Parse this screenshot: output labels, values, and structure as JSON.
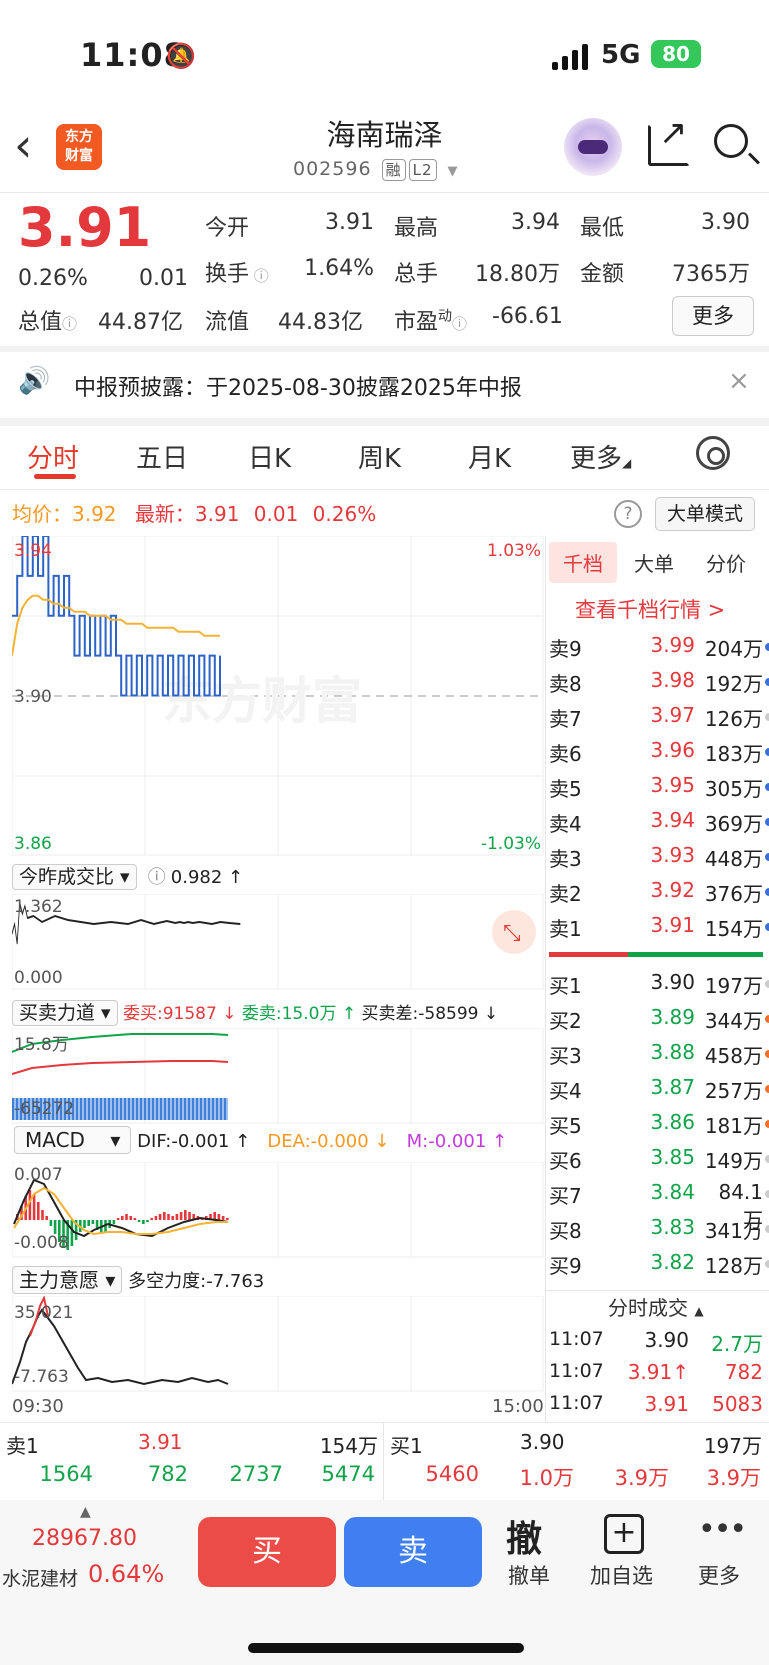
{
  "status_bar": {
    "time": "11:08",
    "network": "5G",
    "battery": "80"
  },
  "header": {
    "logo_text": "东方\n财富",
    "stock_name": "海南瑞泽",
    "stock_code": "002596",
    "tag_rong": "融",
    "tag_l2": "L2"
  },
  "quote": {
    "price": "3.91",
    "change_pct": "0.26%",
    "change": "0.01",
    "open_label": "今开",
    "open": "3.91",
    "high_label": "最高",
    "high": "3.94",
    "low_label": "最低",
    "low": "3.90",
    "turnover_label": "换手",
    "turnover": "1.64%",
    "volume_label": "总手",
    "volume": "18.80万",
    "amount_label": "金额",
    "amount": "7365万",
    "mktcap_label": "总值",
    "mktcap": "44.87亿",
    "float_label": "流值",
    "float": "44.83亿",
    "pe_label": "市盈",
    "pe_sup": "动",
    "pe": "-66.61",
    "more_label": "更多"
  },
  "notice": {
    "text": "中报预披露：于2025-08-30披露2025年中报"
  },
  "tabs": [
    "分时",
    "五日",
    "日K",
    "周K",
    "月K",
    "更多"
  ],
  "stats": {
    "avg_label": "均价：",
    "avg": "3.92",
    "latest_label": "最新：",
    "latest": "3.91",
    "chg": "0.01",
    "pct": "0.26%",
    "mode_label": "大单模式"
  },
  "chart_labels": {
    "top_price": "3.94",
    "mid_price": "3.90",
    "bottom_price": "3.86",
    "top_pct": "1.03%",
    "bottom_pct": "-1.03%",
    "watermark": "东方财富"
  },
  "chart_data": {
    "type": "line",
    "title": "",
    "y_range": [
      3.86,
      3.94
    ],
    "series": [
      {
        "name": "",
        "values": [
          3.92,
          3.93,
          3.94,
          3.93,
          3.94,
          3.93,
          3.94,
          3.92,
          3.93,
          3.92,
          3.93,
          3.92,
          3.91,
          3.92,
          3.91,
          3.92,
          3.91,
          3.92,
          3.91,
          3.92,
          3.91,
          3.9,
          3.91,
          3.9,
          3.91,
          3.9,
          3.91,
          3.9,
          3.91,
          3.9,
          3.91,
          3.9,
          3.91,
          3.9,
          3.91,
          3.9,
          3.91,
          3.9,
          3.91,
          3.9,
          3.91
        ]
      },
      {
        "name": "均价",
        "values": [
          3.91,
          3.918,
          3.922,
          3.924,
          3.925,
          3.925,
          3.924,
          3.924,
          3.923,
          3.923,
          3.922,
          3.922,
          3.921,
          3.921,
          3.921,
          3.92,
          3.92,
          3.92,
          3.92,
          3.919,
          3.919,
          3.919,
          3.918,
          3.918,
          3.918,
          3.918,
          3.917,
          3.917,
          3.917,
          3.917,
          3.917,
          3.917,
          3.916,
          3.916,
          3.916,
          3.916,
          3.916,
          3.915,
          3.915,
          3.915,
          3.915
        ]
      }
    ]
  },
  "panel1": {
    "selector": "今昨成交比",
    "value": "0.982 ↑",
    "top": "1.362",
    "bottom": "0.000"
  },
  "panel2": {
    "selector": "买卖力道",
    "wei_buy": "委买:91587 ↓",
    "wei_sell": "委卖:15.0万 ↑",
    "diff": "买卖差:-58599 ↓",
    "top": "15.8万",
    "bottom": "-65272"
  },
  "panel3": {
    "selector": "MACD",
    "dif": "DIF:-0.001 ↑",
    "dea": "DEA:-0.000 ↓",
    "m": "M:-0.001 ↑",
    "top": "0.007",
    "bottom": "-0.008"
  },
  "panel4": {
    "selector": "主力意愿",
    "value": "多空力度:-7.763",
    "top": "35.021",
    "bottom": "-7.763",
    "t_start": "09:30",
    "t_end": "15:00"
  },
  "orderbook_tabs": [
    "千档",
    "大单",
    "分价"
  ],
  "orderbook_link": "查看千档行情 >",
  "asks": [
    {
      "label": "卖9",
      "price": "3.99",
      "vol": "204万"
    },
    {
      "label": "卖8",
      "price": "3.98",
      "vol": "192万"
    },
    {
      "label": "卖7",
      "price": "3.97",
      "vol": "126万"
    },
    {
      "label": "卖6",
      "price": "3.96",
      "vol": "183万"
    },
    {
      "label": "卖5",
      "price": "3.95",
      "vol": "305万"
    },
    {
      "label": "卖4",
      "price": "3.94",
      "vol": "369万"
    },
    {
      "label": "卖3",
      "price": "3.93",
      "vol": "448万"
    },
    {
      "label": "卖2",
      "price": "3.92",
      "vol": "376万"
    },
    {
      "label": "卖1",
      "price": "3.91",
      "vol": "154万"
    }
  ],
  "bids": [
    {
      "label": "买1",
      "price": "3.90",
      "vol": "197万"
    },
    {
      "label": "买2",
      "price": "3.89",
      "vol": "344万"
    },
    {
      "label": "买3",
      "price": "3.88",
      "vol": "458万"
    },
    {
      "label": "买4",
      "price": "3.87",
      "vol": "257万"
    },
    {
      "label": "买5",
      "price": "3.86",
      "vol": "181万"
    },
    {
      "label": "买6",
      "price": "3.85",
      "vol": "149万"
    },
    {
      "label": "买7",
      "price": "3.84",
      "vol": "84.1万"
    },
    {
      "label": "买8",
      "price": "3.83",
      "vol": "341万"
    },
    {
      "label": "买9",
      "price": "3.82",
      "vol": "128万"
    }
  ],
  "ticks_title": "分时成交",
  "ticks": [
    {
      "time": "11:07",
      "price": "3.90",
      "vol": "2.7万"
    },
    {
      "time": "11:07",
      "price": "3.91↑",
      "vol": "782"
    },
    {
      "time": "11:07",
      "price": "3.91",
      "vol": "5083"
    }
  ],
  "queue_sell": {
    "label": "卖1",
    "price": "3.91",
    "vol": "154万",
    "orders": [
      "1564",
      "782",
      "2737",
      "5474"
    ]
  },
  "queue_buy": {
    "label": "买1",
    "price": "3.90",
    "vol": "197万",
    "orders": [
      "5460",
      "1.0万",
      "3.9万",
      "3.9万"
    ]
  },
  "bottom": {
    "index_value": "28967.80",
    "index_name": "水泥建材",
    "index_pct": "0.64%",
    "buy": "买",
    "sell": "卖",
    "cancel_icon": "撤",
    "cancel": "撤单",
    "add_fav": "加自选",
    "more": "更多"
  }
}
